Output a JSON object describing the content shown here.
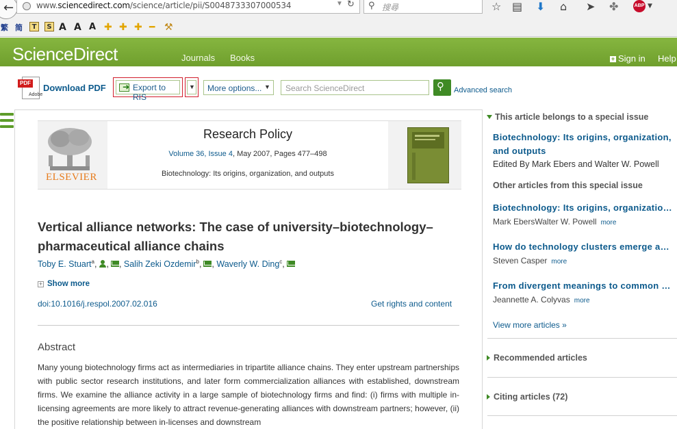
{
  "browser": {
    "url_prefix": "www.",
    "url_domain": "sciencedirect.com",
    "url_path": "/science/article/pii/S0048733307000534",
    "search_placeholder": "搜尋"
  },
  "addons": {
    "trad": "繁",
    "simp": "简",
    "t_btn": "T",
    "s_btn": "S",
    "font_a1": "A",
    "font_a2": "A",
    "font_a3": "A"
  },
  "header": {
    "logo": "ScienceDirect",
    "nav": [
      "Journals",
      "Books"
    ],
    "signin": "Sign in",
    "help": "Help"
  },
  "toolbar": {
    "download_pdf": "Download PDF",
    "pdf_badge": "PDF",
    "pdf_brand": "Adobe",
    "export": "Export to RIS",
    "more_options": "More options...",
    "search_placeholder": "Search ScienceDirect",
    "advanced_search": "Advanced search"
  },
  "journal": {
    "publisher": "ELSEVIER",
    "title": "Research Policy",
    "volume_issue": "Volume 36, Issue 4",
    "date_pages": ", May 2007, Pages 477–498",
    "issue_title": "Biotechnology: Its origins, organization, and outputs"
  },
  "article": {
    "title": "Vertical alliance networks: The case of university–biotechnology–pharmaceutical alliance chains",
    "authors": [
      {
        "name": "Toby E. Stuart",
        "sup": "a"
      },
      {
        "name": "Salih Zeki Ozdemir",
        "sup": "b"
      },
      {
        "name": "Waverly W. Ding",
        "sup": "c"
      }
    ],
    "show_more": "Show more",
    "doi": "doi:10.1016/j.respol.2007.02.016",
    "rights": "Get rights and content",
    "abstract_heading": "Abstract",
    "abstract_text": "Many young biotechnology firms act as intermediaries in tripartite alliance chains. They enter upstream partnerships with public sector research institutions, and later form commercialization alliances with established, downstream firms. We examine the alliance activity in a large sample of biotechnology firms and find: (i) firms with multiple in-licensing agreements are more likely to attract revenue-generating alliances with downstream partners; however, (ii) the positive relationship between in-licenses and downstream"
  },
  "sidebar": {
    "special_issue_heading": "This article belongs to a special issue",
    "issue_link": "Biotechnology: Its origins, organization, and outputs",
    "issue_editors": "Edited By Mark Ebers and Walter W. Powell",
    "other_heading": "Other articles from this special issue",
    "articles": [
      {
        "title": "Biotechnology: Its origins, organization, and outputs",
        "authors": "Mark EbersWalter W. Powell"
      },
      {
        "title": "How do technology clusters emerge and become sustainable?",
        "authors": "Steven Casper"
      },
      {
        "title": "From divergent meanings to common practices",
        "authors": "Jeannette A. Colyvas"
      }
    ],
    "more_label": "more",
    "view_more": "View more articles »",
    "recommended": "Recommended articles",
    "citing": "Citing articles (72)"
  }
}
